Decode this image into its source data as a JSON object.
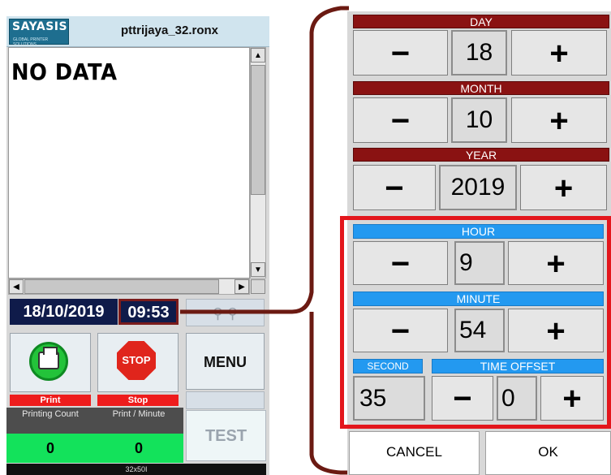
{
  "app": {
    "logo_text": "SAYASIS",
    "logo_tagline": "GLOBAL PRINTER SOLUTIONS",
    "filename": "pttrijaya_32.ronx"
  },
  "display": {
    "message": "NO DATA"
  },
  "clock": {
    "date": "18/10/2019",
    "time": "09:53"
  },
  "buttons": {
    "print_label": "Print",
    "stop_label": "Stop",
    "stop_icon_text": "STOP",
    "menu_label": "MENU",
    "test_label": "TEST",
    "zoom_icons": "⚲ ⚲"
  },
  "counters": {
    "printing_count_label": "Printing Count",
    "printing_count_value": "0",
    "print_per_minute_label": "Print / Minute",
    "print_per_minute_value": "0"
  },
  "status": {
    "resolution": "32x50I"
  },
  "dialog": {
    "day": {
      "label": "DAY",
      "value": "18",
      "minus": "−",
      "plus": "+"
    },
    "month": {
      "label": "MONTH",
      "value": "10",
      "minus": "−",
      "plus": "+"
    },
    "year": {
      "label": "YEAR",
      "value": "2019",
      "minus": "−",
      "plus": "+"
    },
    "hour": {
      "label": "HOUR",
      "value": "9",
      "minus": "−",
      "plus": "+"
    },
    "minute": {
      "label": "MINUTE",
      "value": "54",
      "minus": "−",
      "plus": "+"
    },
    "second": {
      "label": "SECOND",
      "value": "35"
    },
    "time_offset": {
      "label": "TIME OFFSET",
      "value": "0",
      "minus": "−",
      "plus": "+"
    },
    "cancel_label": "CANCEL",
    "ok_label": "OK"
  },
  "colors": {
    "header_red": "#8a1212",
    "header_blue": "#2399f0",
    "counter_green": "#13e25b",
    "highlight_red": "#e3161c",
    "clock_navy": "#0f1b4a"
  },
  "icons": {
    "print": "printer-icon",
    "stop": "stop-sign-icon",
    "zoom": "zoom-icon"
  }
}
